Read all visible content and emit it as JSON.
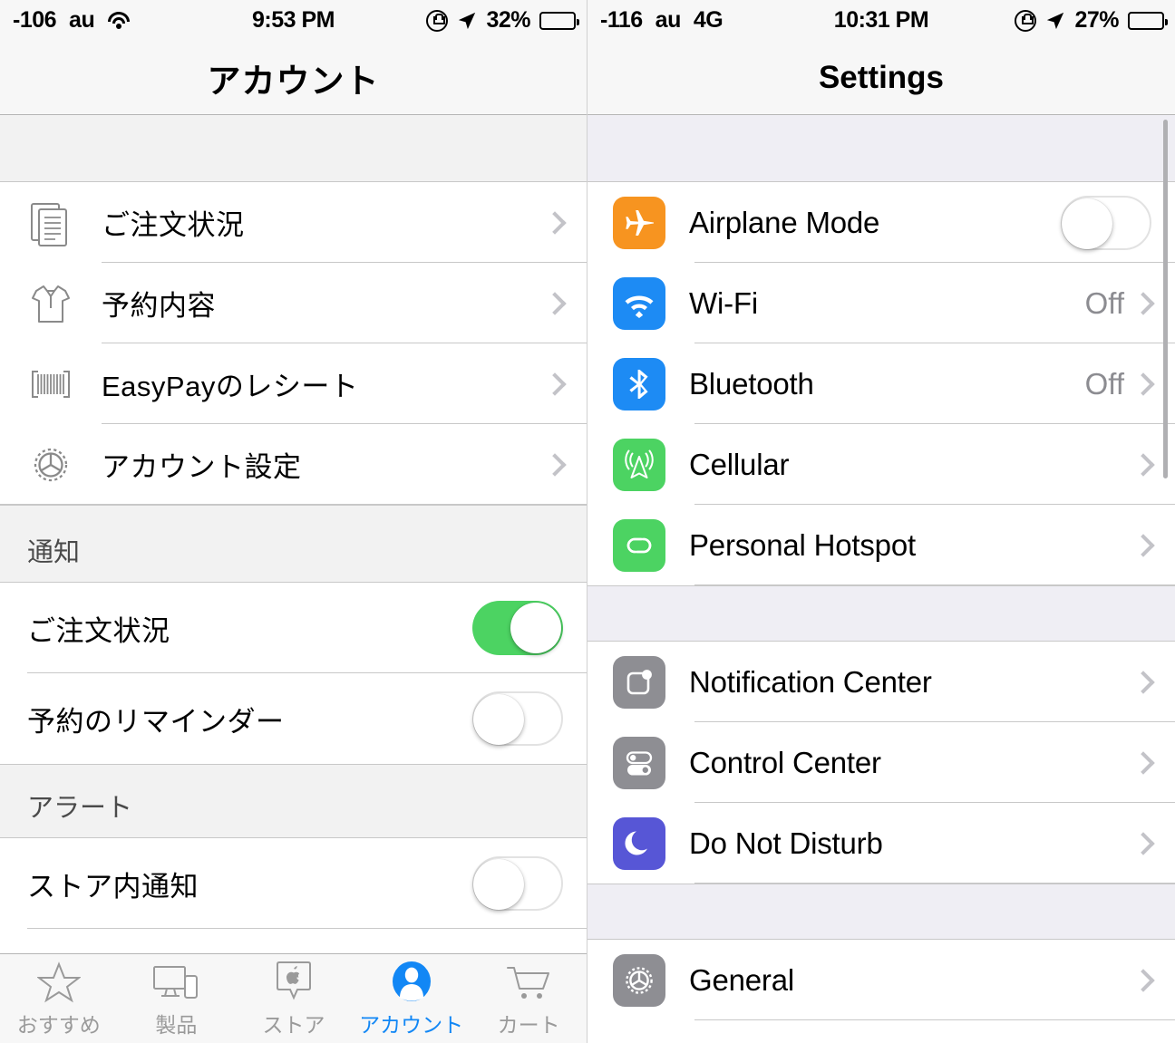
{
  "left": {
    "status": {
      "signal": "-106",
      "carrier": "au",
      "wifi_icon": "wifi-icon",
      "time": "9:53 PM",
      "rotation_lock_icon": "rotation-lock-icon",
      "location_icon": "location-arrow-icon",
      "battery_percent": "32%",
      "battery_level": 32
    },
    "title": "アカウント",
    "menu_items": [
      {
        "icon": "documents-icon",
        "label": "ご注文状況"
      },
      {
        "icon": "tshirt-icon",
        "label": "予約内容"
      },
      {
        "icon": "barcode-icon",
        "label": "EasyPayのレシート"
      },
      {
        "icon": "gear-icon",
        "label": "アカウント設定"
      }
    ],
    "notifications_header": "通知",
    "notification_toggles": [
      {
        "label": "ご注文状況",
        "state": "on"
      },
      {
        "label": "予約のリマインダー",
        "state": "off"
      }
    ],
    "alerts_header": "アラート",
    "alert_toggles": [
      {
        "label": "ストア内通知",
        "state": "off"
      }
    ],
    "tabs": [
      {
        "icon": "star-icon",
        "label": "おすすめ",
        "active": false
      },
      {
        "icon": "devices-icon",
        "label": "製品",
        "active": false
      },
      {
        "icon": "store-pin-icon",
        "label": "ストア",
        "active": false
      },
      {
        "icon": "account-person-icon",
        "label": "アカウント",
        "active": true
      },
      {
        "icon": "cart-icon",
        "label": "カート",
        "active": false
      }
    ],
    "accent_color": "#1287F5",
    "toggle_on_color": "#4CD362"
  },
  "right": {
    "status": {
      "signal": "-116",
      "carrier": "au",
      "network": "4G",
      "time": "10:31 PM",
      "rotation_lock_icon": "rotation-lock-icon",
      "location_icon": "location-arrow-icon",
      "battery_percent": "27%",
      "battery_level": 27
    },
    "title": "Settings",
    "group1": [
      {
        "icon": "airplane-icon",
        "icon_color": "#F79420",
        "label": "Airplane Mode",
        "control": "toggle",
        "state": "off"
      },
      {
        "icon": "wifi-icon",
        "icon_color": "#1D8BF4",
        "label": "Wi-Fi",
        "control": "value",
        "value": "Off"
      },
      {
        "icon": "bluetooth-icon",
        "icon_color": "#1D8BF4",
        "label": "Bluetooth",
        "control": "value",
        "value": "Off"
      },
      {
        "icon": "cellular-antenna-icon",
        "icon_color": "#4CD362",
        "label": "Cellular",
        "control": "chevron",
        "value": ""
      },
      {
        "icon": "hotspot-link-icon",
        "icon_color": "#4CD362",
        "label": "Personal Hotspot",
        "control": "chevron",
        "value": ""
      }
    ],
    "group2": [
      {
        "icon": "notification-center-icon",
        "icon_color": "#8E8E93",
        "label": "Notification Center",
        "control": "chevron"
      },
      {
        "icon": "control-center-icon",
        "icon_color": "#8E8E93",
        "label": "Control Center",
        "control": "chevron"
      },
      {
        "icon": "moon-icon",
        "icon_color": "#5756D6",
        "label": "Do Not Disturb",
        "control": "chevron"
      }
    ],
    "group3": [
      {
        "icon": "gear-icon",
        "icon_color": "#8E8E93",
        "label": "General",
        "control": "chevron"
      }
    ]
  }
}
